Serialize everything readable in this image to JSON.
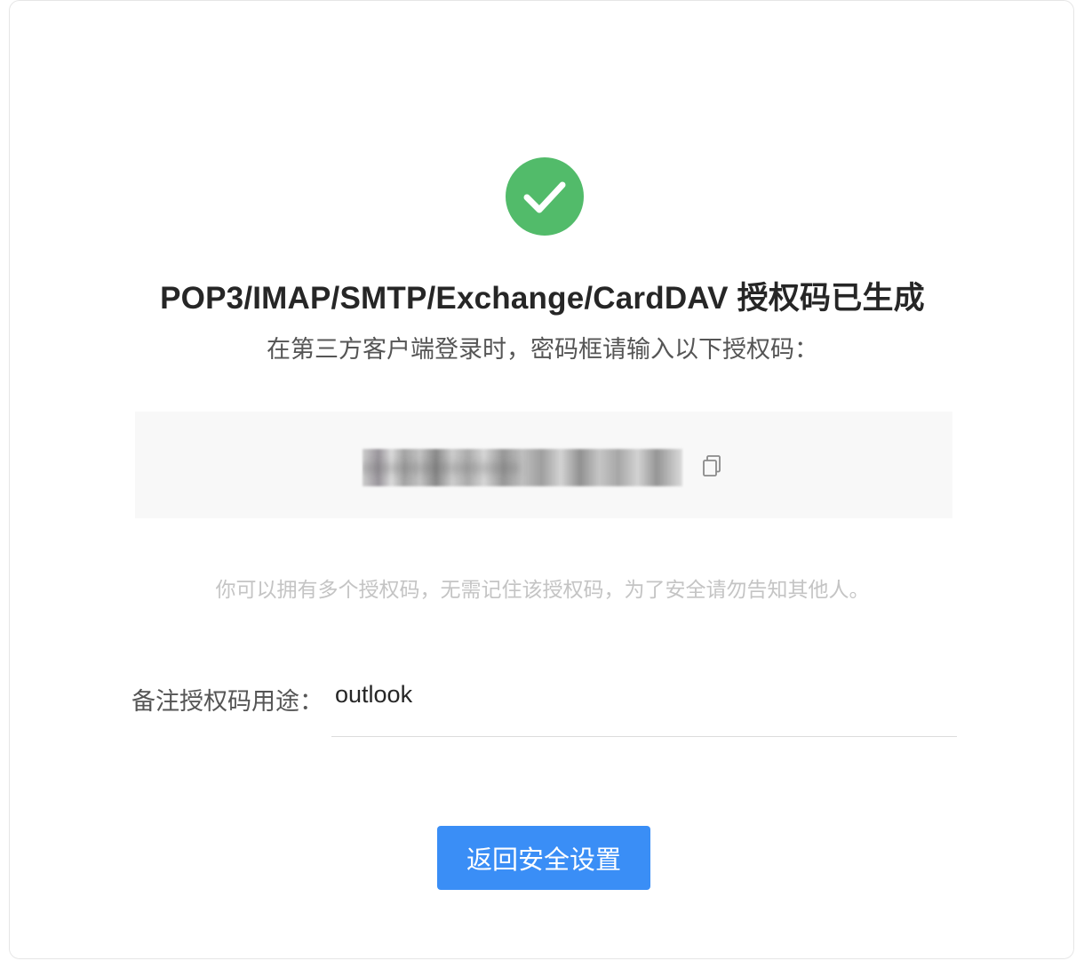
{
  "success": {
    "icon": "check-circle-icon",
    "color": "#52bb6a"
  },
  "title": "POP3/IMAP/SMTP/Exchange/CardDAV 授权码已生成",
  "subtitle": "在第三方客户端登录时，密码框请输入以下授权码：",
  "auth_code": {
    "value": "••••••••••••••••",
    "copy_icon": "copy-icon"
  },
  "hint": "你可以拥有多个授权码，无需记住该授权码，为了安全请勿告知其他人。",
  "remark": {
    "label": "备注授权码用途：",
    "value": "outlook"
  },
  "back_button": {
    "label": "返回安全设置",
    "color": "#3a8ef6"
  }
}
